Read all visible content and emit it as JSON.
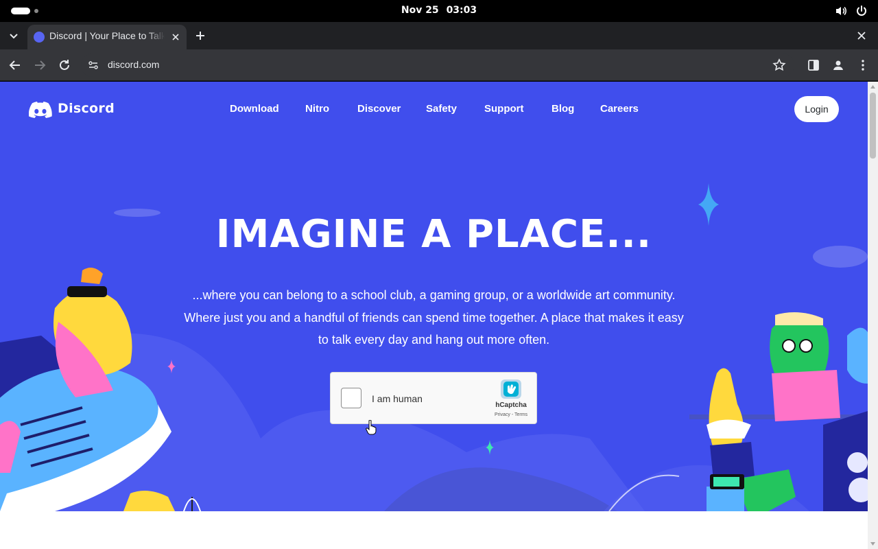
{
  "system": {
    "date": "Nov 25",
    "time": "03:03",
    "icons": [
      "volume-icon",
      "power-icon"
    ]
  },
  "browser": {
    "tab_title": "Discord | Your Place to Talk and Hang Out",
    "url": "discord.com",
    "icons": [
      "tab-search-icon",
      "new-tab-icon",
      "close-window-icon",
      "back-icon",
      "forward-icon",
      "reload-icon",
      "site-info-icon",
      "bookmark-star-icon",
      "side-panel-icon",
      "profile-icon",
      "menu-icon"
    ]
  },
  "page": {
    "brand": "Discord",
    "nav": [
      "Download",
      "Nitro",
      "Discover",
      "Safety",
      "Support",
      "Blog",
      "Careers"
    ],
    "login_label": "Login",
    "headline": "IMAGINE A PLACE...",
    "sub_lines": [
      "...where you can belong to a school club, a gaming group, or a worldwide art community.",
      "Where just you and a handful of friends can spend time together. A place that makes it easy",
      "to talk every day and hang out more often."
    ],
    "captcha": {
      "label": "I am human",
      "brand": "hCaptcha",
      "terms": "Privacy - Terms"
    },
    "colors": {
      "hero": "#404eed",
      "blurple": "#5865f2"
    }
  }
}
